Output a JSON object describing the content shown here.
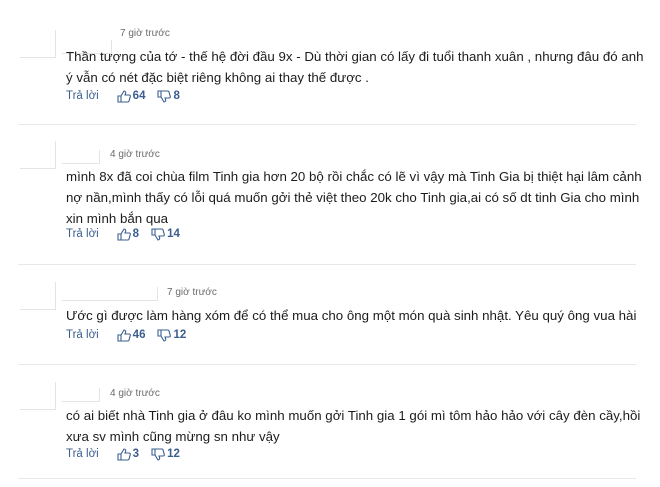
{
  "comments": [
    {
      "time": "7 giờ trước",
      "text": "Thần tượng của tớ - thế hệ đời đầu 9x - Dù thời gian có lấy đi tuổi thanh xuân , nhưng đâu đó anh ý vẫn có nét đặc biệt riêng không ai thay thế được .",
      "reply": "Trả lời",
      "likes": "64",
      "dislikes": "8"
    },
    {
      "time": "4 giờ trước",
      "text": "mình 8x đã coi chùa film Tinh gia hơn 20 bộ rồi chắc có lẽ vì vậy mà Tinh Gia bị thiệt hại lâm cảnh nợ nần,mình thấy có lỗi quá muốn gởi thẻ việt theo 20k cho Tinh gia,ai có số dt tinh Gia cho mình xin mình bắn qua",
      "reply": "Trả lời",
      "likes": "8",
      "dislikes": "14"
    },
    {
      "time": "7 giờ trước",
      "text": "Ước gì được làm hàng xóm để có thể mua cho ông một món quà sinh nhật. Yêu quý ông vua hài",
      "reply": "Trả lời",
      "likes": "46",
      "dislikes": "12"
    },
    {
      "time": "4 giờ trước",
      "text": "có ai biết nhà Tinh gia ở đâu ko mình muốn gởi Tinh gia 1 gói mì tôm hảo hảo với cây đèn cầy,hồi xưa sv mình cũng mừng sn như vậy",
      "reply": "Trả lời",
      "likes": "3",
      "dislikes": "12"
    }
  ],
  "icons": {
    "like": "thumbs-up-icon",
    "dislike": "thumbs-down-icon"
  },
  "colors": {
    "action": "#3b5d8f",
    "divider": "#e8e8e8"
  }
}
